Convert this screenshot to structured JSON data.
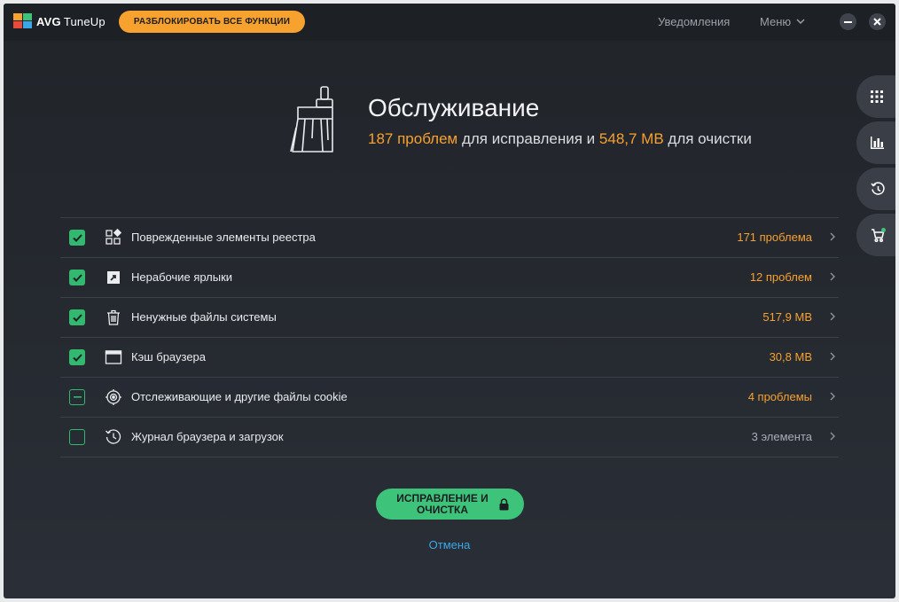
{
  "app": {
    "brand": "AVG",
    "product": "TuneUp",
    "unlock_label": "РАЗБЛОКИРОВАТЬ ВСЕ ФУНКЦИИ",
    "notifications_label": "Уведомления",
    "menu_label": "Меню"
  },
  "header": {
    "title": "Обслуживание",
    "problems_count": "187 проблем",
    "mid_text": " для исправления и ",
    "size_text": "548,7 MB",
    "end_text": " для очистки"
  },
  "rail": [
    "grid-icon",
    "chart-icon",
    "history-icon",
    "cart-icon"
  ],
  "items": [
    {
      "label": "Поврежденные элементы реестра",
      "value": "171 проблема",
      "state": "checked",
      "icon": "registry-icon"
    },
    {
      "label": "Нерабочие ярлыки",
      "value": "12 проблем",
      "state": "checked",
      "icon": "shortcut-icon"
    },
    {
      "label": "Ненужные файлы системы",
      "value": "517,9 MB",
      "state": "checked",
      "icon": "trash-icon"
    },
    {
      "label": "Кэш браузера",
      "value": "30,8 MB",
      "state": "checked",
      "icon": "browser-icon"
    },
    {
      "label": "Отслеживающие и другие файлы cookie",
      "value": "4 проблемы",
      "state": "partial",
      "icon": "tracking-icon"
    },
    {
      "label": "Журнал браузера и загрузок",
      "value": "3 элемента",
      "state": "unchecked",
      "icon": "history-icon"
    }
  ],
  "actions": {
    "fix_label": "ИСПРАВЛЕНИЕ И ОЧИСТКА",
    "cancel_label": "Отмена"
  },
  "colors": {
    "accent_orange": "#f7a12e",
    "accent_green": "#3ec37a",
    "link_blue": "#3aa7e8",
    "background": "#24272d"
  }
}
